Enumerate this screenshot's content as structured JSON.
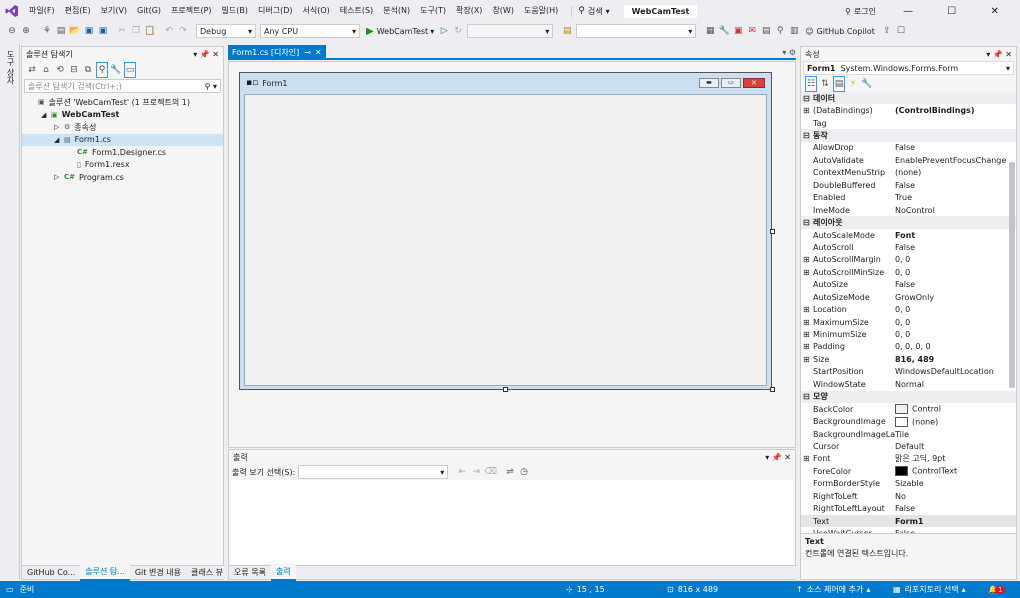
{
  "menu": {
    "items": [
      "파일(F)",
      "편집(E)",
      "보기(V)",
      "Git(G)",
      "프로젝트(P)",
      "빌드(B)",
      "디버그(D)",
      "서식(O)",
      "테스트(S)",
      "분석(N)",
      "도구(T)",
      "확장(X)",
      "창(W)",
      "도움말(H)"
    ],
    "search": "검색",
    "solution_name": "WebCamTest",
    "login": "로그인"
  },
  "toolbar": {
    "config": "Debug",
    "platform": "Any CPU",
    "run_label": "WebCamTest",
    "copilot": "GitHub Copilot"
  },
  "left_strip": {
    "label": "도구 상자"
  },
  "solution_explorer": {
    "title": "솔루션 탐색기",
    "search_placeholder": "솔루션 탐색기 검색(Ctrl+;)",
    "tree": [
      {
        "label": "솔루션 'WebCamTest' (1 프로젝트의 1)",
        "indent": 0,
        "icon": "solution-icon",
        "bold": false,
        "selected": false
      },
      {
        "label": "WebCamTest",
        "indent": 1,
        "icon": "project-icon",
        "bold": true,
        "selected": false
      },
      {
        "label": "종속성",
        "indent": 2,
        "icon": "dependencies-icon",
        "bold": false,
        "selected": false
      },
      {
        "label": "Form1.cs",
        "indent": 2,
        "icon": "form-icon",
        "bold": false,
        "selected": true
      },
      {
        "label": "Form1.Designer.cs",
        "indent": 3,
        "icon": "csharp-icon",
        "bold": false,
        "selected": false
      },
      {
        "label": "Form1.resx",
        "indent": 3,
        "icon": "resx-icon",
        "bold": false,
        "selected": false
      },
      {
        "label": "Program.cs",
        "indent": 2,
        "icon": "csharp-icon",
        "bold": false,
        "selected": false
      }
    ],
    "bottom_tabs": [
      "GitHub Co...",
      "솔루션 탐...",
      "Git 변경 내용",
      "클래스 뷰"
    ]
  },
  "editor": {
    "tab_label": "Form1.cs [디자인]",
    "form_title": "Form1"
  },
  "output": {
    "title": "출력",
    "source_label": "출력 보기 선택(S):",
    "tabs": [
      "오류 목록",
      "출력"
    ]
  },
  "properties": {
    "title": "속성",
    "object_name": "Form1",
    "object_type": "System.Windows.Forms.Form",
    "rows": [
      {
        "kind": "cat",
        "name": "데이터"
      },
      {
        "kind": "prop",
        "name": "(DataBindings)",
        "value": "(ControlBindings)",
        "expand": true,
        "bold": true
      },
      {
        "kind": "prop",
        "name": "Tag",
        "value": ""
      },
      {
        "kind": "cat",
        "name": "동작"
      },
      {
        "kind": "prop",
        "name": "AllowDrop",
        "value": "False"
      },
      {
        "kind": "prop",
        "name": "AutoValidate",
        "value": "EnablePreventFocusChange"
      },
      {
        "kind": "prop",
        "name": "ContextMenuStrip",
        "value": "(none)"
      },
      {
        "kind": "prop",
        "name": "DoubleBuffered",
        "value": "False"
      },
      {
        "kind": "prop",
        "name": "Enabled",
        "value": "True"
      },
      {
        "kind": "prop",
        "name": "ImeMode",
        "value": "NoControl"
      },
      {
        "kind": "cat",
        "name": "레이아웃"
      },
      {
        "kind": "prop",
        "name": "AutoScaleMode",
        "value": "Font",
        "bold": true
      },
      {
        "kind": "prop",
        "name": "AutoScroll",
        "value": "False"
      },
      {
        "kind": "prop",
        "name": "AutoScrollMargin",
        "value": "0, 0",
        "expand": true
      },
      {
        "kind": "prop",
        "name": "AutoScrollMinSize",
        "value": "0, 0",
        "expand": true
      },
      {
        "kind": "prop",
        "name": "AutoSize",
        "value": "False"
      },
      {
        "kind": "prop",
        "name": "AutoSizeMode",
        "value": "GrowOnly"
      },
      {
        "kind": "prop",
        "name": "Location",
        "value": "0, 0",
        "expand": true
      },
      {
        "kind": "prop",
        "name": "MaximumSize",
        "value": "0, 0",
        "expand": true
      },
      {
        "kind": "prop",
        "name": "MinimumSize",
        "value": "0, 0",
        "expand": true
      },
      {
        "kind": "prop",
        "name": "Padding",
        "value": "0, 0, 0, 0",
        "expand": true
      },
      {
        "kind": "prop",
        "name": "Size",
        "value": "816, 489",
        "expand": true,
        "bold": true
      },
      {
        "kind": "prop",
        "name": "StartPosition",
        "value": "WindowsDefaultLocation"
      },
      {
        "kind": "prop",
        "name": "WindowState",
        "value": "Normal"
      },
      {
        "kind": "cat",
        "name": "모양"
      },
      {
        "kind": "prop",
        "name": "BackColor",
        "value": "Control",
        "swatch": "#f0f0f0"
      },
      {
        "kind": "prop",
        "name": "BackgroundImage",
        "value": "(none)",
        "swatch": "#ffffff"
      },
      {
        "kind": "prop",
        "name": "BackgroundImageLayout",
        "value": "Tile"
      },
      {
        "kind": "prop",
        "name": "Cursor",
        "value": "Default"
      },
      {
        "kind": "prop",
        "name": "Font",
        "value": "맑은 고딕, 9pt",
        "expand": true
      },
      {
        "kind": "prop",
        "name": "ForeColor",
        "value": "ControlText",
        "swatch": "#000000"
      },
      {
        "kind": "prop",
        "name": "FormBorderStyle",
        "value": "Sizable"
      },
      {
        "kind": "prop",
        "name": "RightToLeft",
        "value": "No"
      },
      {
        "kind": "prop",
        "name": "RightToLeftLayout",
        "value": "False"
      },
      {
        "kind": "prop",
        "name": "Text",
        "value": "Form1",
        "bold": true
      },
      {
        "kind": "prop",
        "name": "UseWaitCursor",
        "value": "False"
      }
    ],
    "desc_title": "Text",
    "desc_text": "컨트롤에 연결된 텍스트입니다."
  },
  "status": {
    "ready": "준비",
    "position": "15 , 15",
    "size": "816 x 489",
    "source_control": "소스 제어에 추가",
    "repo": "리포지토리 선택",
    "notif_count": "1"
  },
  "colors": {
    "accent": "#007acc",
    "title_active": "#e81123"
  }
}
